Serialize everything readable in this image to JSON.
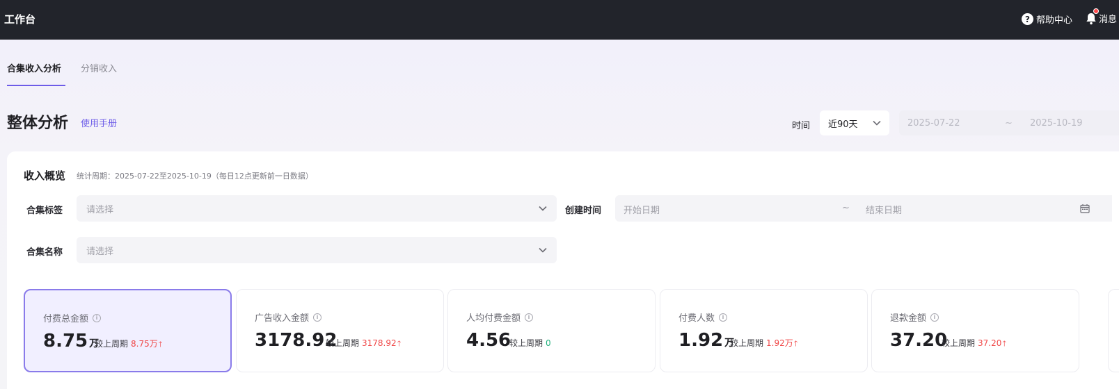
{
  "topbar": {
    "brand": "工作台",
    "help_label": "帮助中心",
    "message_label": "消息"
  },
  "tabs": [
    {
      "label": "合集收入分析",
      "active": true
    },
    {
      "label": "分销收入",
      "active": false
    }
  ],
  "header": {
    "title": "整体分析",
    "manual_link": "使用手册",
    "time_label": "时间",
    "time_range_value": "近90天",
    "date_start": "2025-07-22",
    "date_separator": "~",
    "date_end": "2025-10-19"
  },
  "overview": {
    "title": "收入概览",
    "subtitle": "统计周期：2025-07-22至2025-10-19（每日12点更新前一日数据）",
    "filters": {
      "tag_label": "合集标签",
      "tag_placeholder": "请选择",
      "create_time_label": "创建时间",
      "start_placeholder": "开始日期",
      "range_separator": "~",
      "end_placeholder": "结束日期",
      "name_label": "合集名称",
      "name_placeholder": "请选择"
    },
    "compare_label": "较上周期",
    "metrics": [
      {
        "title": "付费总金额",
        "value": "8.75",
        "unit": "万",
        "delta": "8.75万",
        "trend": "up",
        "active": true
      },
      {
        "title": "广告收入金额",
        "value": "3178.92",
        "unit": "",
        "delta": "3178.92",
        "trend": "up",
        "active": false
      },
      {
        "title": "人均付费金额",
        "value": "4.56",
        "unit": "",
        "delta": "0",
        "trend": "flat",
        "active": false
      },
      {
        "title": "付费人数",
        "value": "1.92",
        "unit": "万",
        "delta": "1.92万",
        "trend": "up",
        "active": false
      },
      {
        "title": "退款金额",
        "value": "37.20",
        "unit": "",
        "delta": "37.20",
        "trend": "up",
        "active": false
      }
    ]
  },
  "colors": {
    "accent": "#6d5ce8",
    "topbar": "#22242b",
    "up": "#f04848",
    "flat": "#22b07d"
  }
}
